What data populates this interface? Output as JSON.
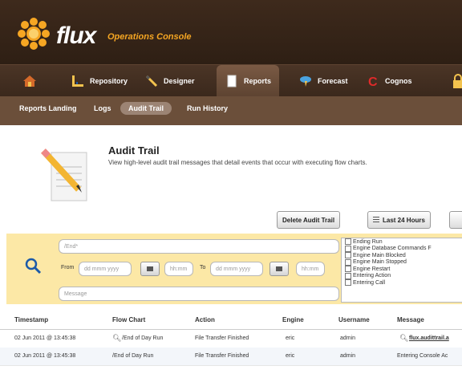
{
  "header": {
    "brand": "flux",
    "subtitle": "Operations Console",
    "brand_colors": {
      "header_bg": "#3e2a1c",
      "accent": "#f6a623"
    }
  },
  "tabs": [
    {
      "label": "",
      "icon": "home-icon"
    },
    {
      "label": "Repository",
      "icon": "ruler-icon"
    },
    {
      "label": "Designer",
      "icon": "pencil-icon"
    },
    {
      "label": "Reports",
      "icon": "document-icon",
      "active": true
    },
    {
      "label": "Forecast",
      "icon": "cloud-icon"
    },
    {
      "label": "Cognos",
      "icon": "cognos-icon"
    }
  ],
  "subnav": [
    {
      "label": "Reports Landing"
    },
    {
      "label": "Logs"
    },
    {
      "label": "Audit Trail",
      "active": true
    },
    {
      "label": "Run History"
    }
  ],
  "page": {
    "title": "Audit Trail",
    "description": "View high-level audit trail messages that detail events that occur with executing flow charts."
  },
  "toolbar": {
    "delete_label": "Delete Audit Trail",
    "range_label": "Last 24 Hours"
  },
  "filters": {
    "flowchart_placeholder": "/End*",
    "from_label": "From",
    "to_label": "To",
    "date_placeholder": "dd mmm yyyy",
    "time_placeholder": "hh:mm",
    "message_placeholder": "Message",
    "actions": [
      "Ending Run",
      "Engine Database Commands F",
      "Engine Main Blocked",
      "Engine Main Stopped",
      "Engine Restart",
      "Entering Action",
      "Entering Call"
    ]
  },
  "table": {
    "columns": [
      "Timestamp",
      "Flow Chart",
      "Action",
      "Engine",
      "Username",
      "Message"
    ],
    "rows": [
      [
        "02 Jun 2011 @ 13:45:38",
        "/End of Day Run",
        "File Transfer Finished",
        "eric",
        "admin",
        "flux.audittrail.a"
      ],
      [
        "02 Jun 2011 @ 13:45:38",
        "/End of Day Run",
        "File Transfer Finished",
        "eric",
        "admin",
        "Entering Console Ac"
      ]
    ]
  }
}
